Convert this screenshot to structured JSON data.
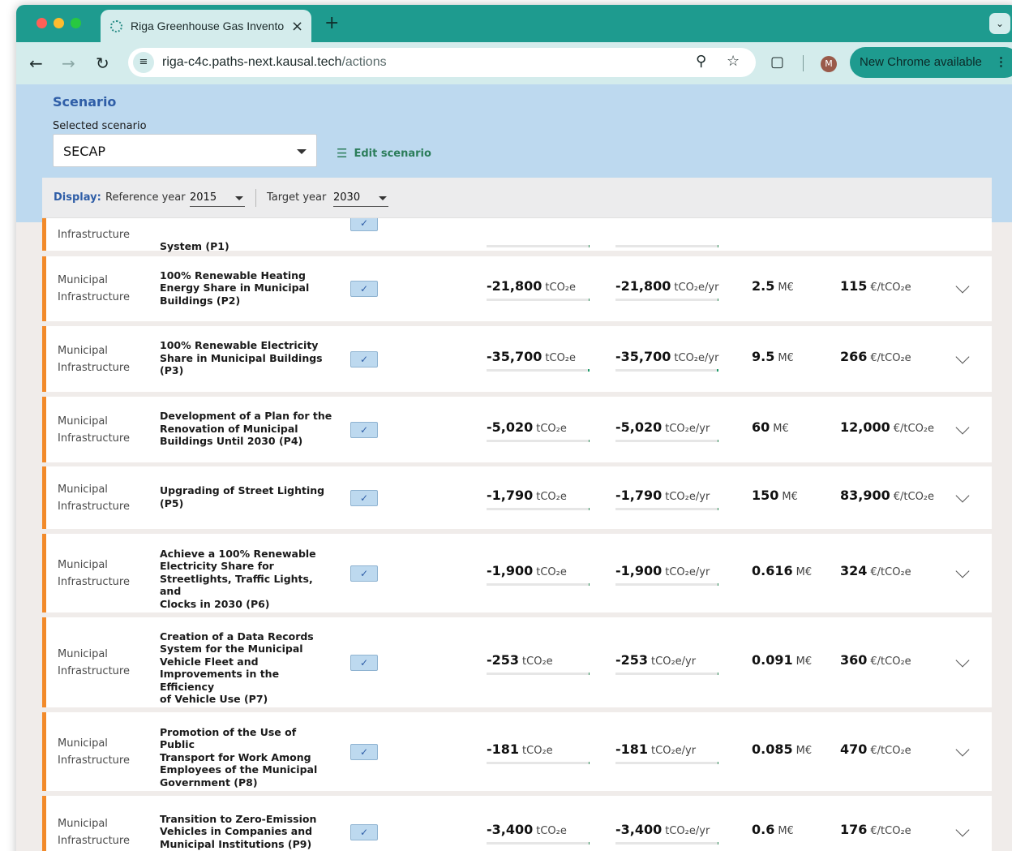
{
  "browser": {
    "tab_title": "Riga Greenhouse Gas Inventory",
    "tab_close": "×",
    "new_tab": "+",
    "url_host": "riga-c4c.paths-next.kausal.tech",
    "url_path": "/actions",
    "new_chrome": "New Chrome available",
    "profile_initial": "M",
    "colors": {
      "tab_strip": "#1e9b8f",
      "toolbar": "#d4ecec"
    }
  },
  "scenario": {
    "title": "Scenario",
    "selected_label": "Selected scenario",
    "selected_value": "SECAP",
    "edit_label": "Edit scenario"
  },
  "display": {
    "label": "Display:",
    "reference_label": "Reference year",
    "reference_value": "2015",
    "target_label": "Target year",
    "target_value": "2030"
  },
  "units": {
    "impact": "tCO₂e",
    "annual": "tCO₂e/yr",
    "cost": "M€",
    "efficiency": "€/tCO₂e"
  },
  "actions": [
    {
      "category": [
        "",
        "Infrastructure"
      ],
      "name": [
        "System (P1)"
      ],
      "impact": "",
      "annual": "",
      "cost": "",
      "efficiency": "",
      "bar_fill": 0,
      "partial": true
    },
    {
      "category": [
        "Municipal",
        "Infrastructure"
      ],
      "name": [
        "100% Renewable Heating",
        "Energy Share in Municipal",
        "Buildings (P2)"
      ],
      "impact": "-21,800",
      "annual": "-21,800",
      "cost": "2.5",
      "efficiency": "115",
      "bar_fill": 0.01
    },
    {
      "category": [
        "Municipal",
        "Infrastructure"
      ],
      "name": [
        "100% Renewable Electricity",
        "Share in Municipal Buildings",
        "(P3)"
      ],
      "impact": "-35,700",
      "annual": "-35,700",
      "cost": "9.5",
      "efficiency": "266",
      "bar_fill": 0.016
    },
    {
      "category": [
        "Municipal",
        "Infrastructure"
      ],
      "name": [
        "Development of a Plan for the",
        "Renovation of Municipal",
        "Buildings Until 2030 (P4)"
      ],
      "impact": "-5,020",
      "annual": "-5,020",
      "cost": "60",
      "efficiency": "12,000",
      "bar_fill": 0.003
    },
    {
      "category": [
        "Municipal",
        "Infrastructure"
      ],
      "name": [
        "Upgrading of Street Lighting",
        "(P5)"
      ],
      "impact": "-1,790",
      "annual": "-1,790",
      "cost": "150",
      "efficiency": "83,900",
      "bar_fill": 0.001
    },
    {
      "category": [
        "Municipal",
        "Infrastructure"
      ],
      "name": [
        "Achieve a 100% Renewable",
        "Electricity Share for",
        "Streetlights, Traffic Lights, and",
        "Clocks in 2030 (P6)"
      ],
      "impact": "-1,900",
      "annual": "-1,900",
      "cost": "0.616",
      "efficiency": "324",
      "bar_fill": 0.001
    },
    {
      "category": [
        "Municipal",
        "Infrastructure"
      ],
      "name": [
        "Creation of a Data Records",
        "System for the Municipal",
        "Vehicle Fleet and",
        "Improvements in the Efficiency",
        "of Vehicle Use (P7)"
      ],
      "impact": "-253",
      "annual": "-253",
      "cost": "0.091",
      "efficiency": "360",
      "bar_fill": 0.0005
    },
    {
      "category": [
        "Municipal",
        "Infrastructure"
      ],
      "name": [
        "Promotion of the Use of Public",
        "Transport for Work Among",
        "Employees of the Municipal",
        "Government (P8)"
      ],
      "impact": "-181",
      "annual": "-181",
      "cost": "0.085",
      "efficiency": "470",
      "bar_fill": 0.0005
    },
    {
      "category": [
        "Municipal",
        "Infrastructure"
      ],
      "name": [
        "Transition to Zero-Emission",
        "Vehicles in Companies and",
        "Municipal Institutions (P9)"
      ],
      "impact": "-3,400",
      "annual": "-3,400",
      "cost": "0.6",
      "efficiency": "176",
      "bar_fill": 0.002
    }
  ]
}
